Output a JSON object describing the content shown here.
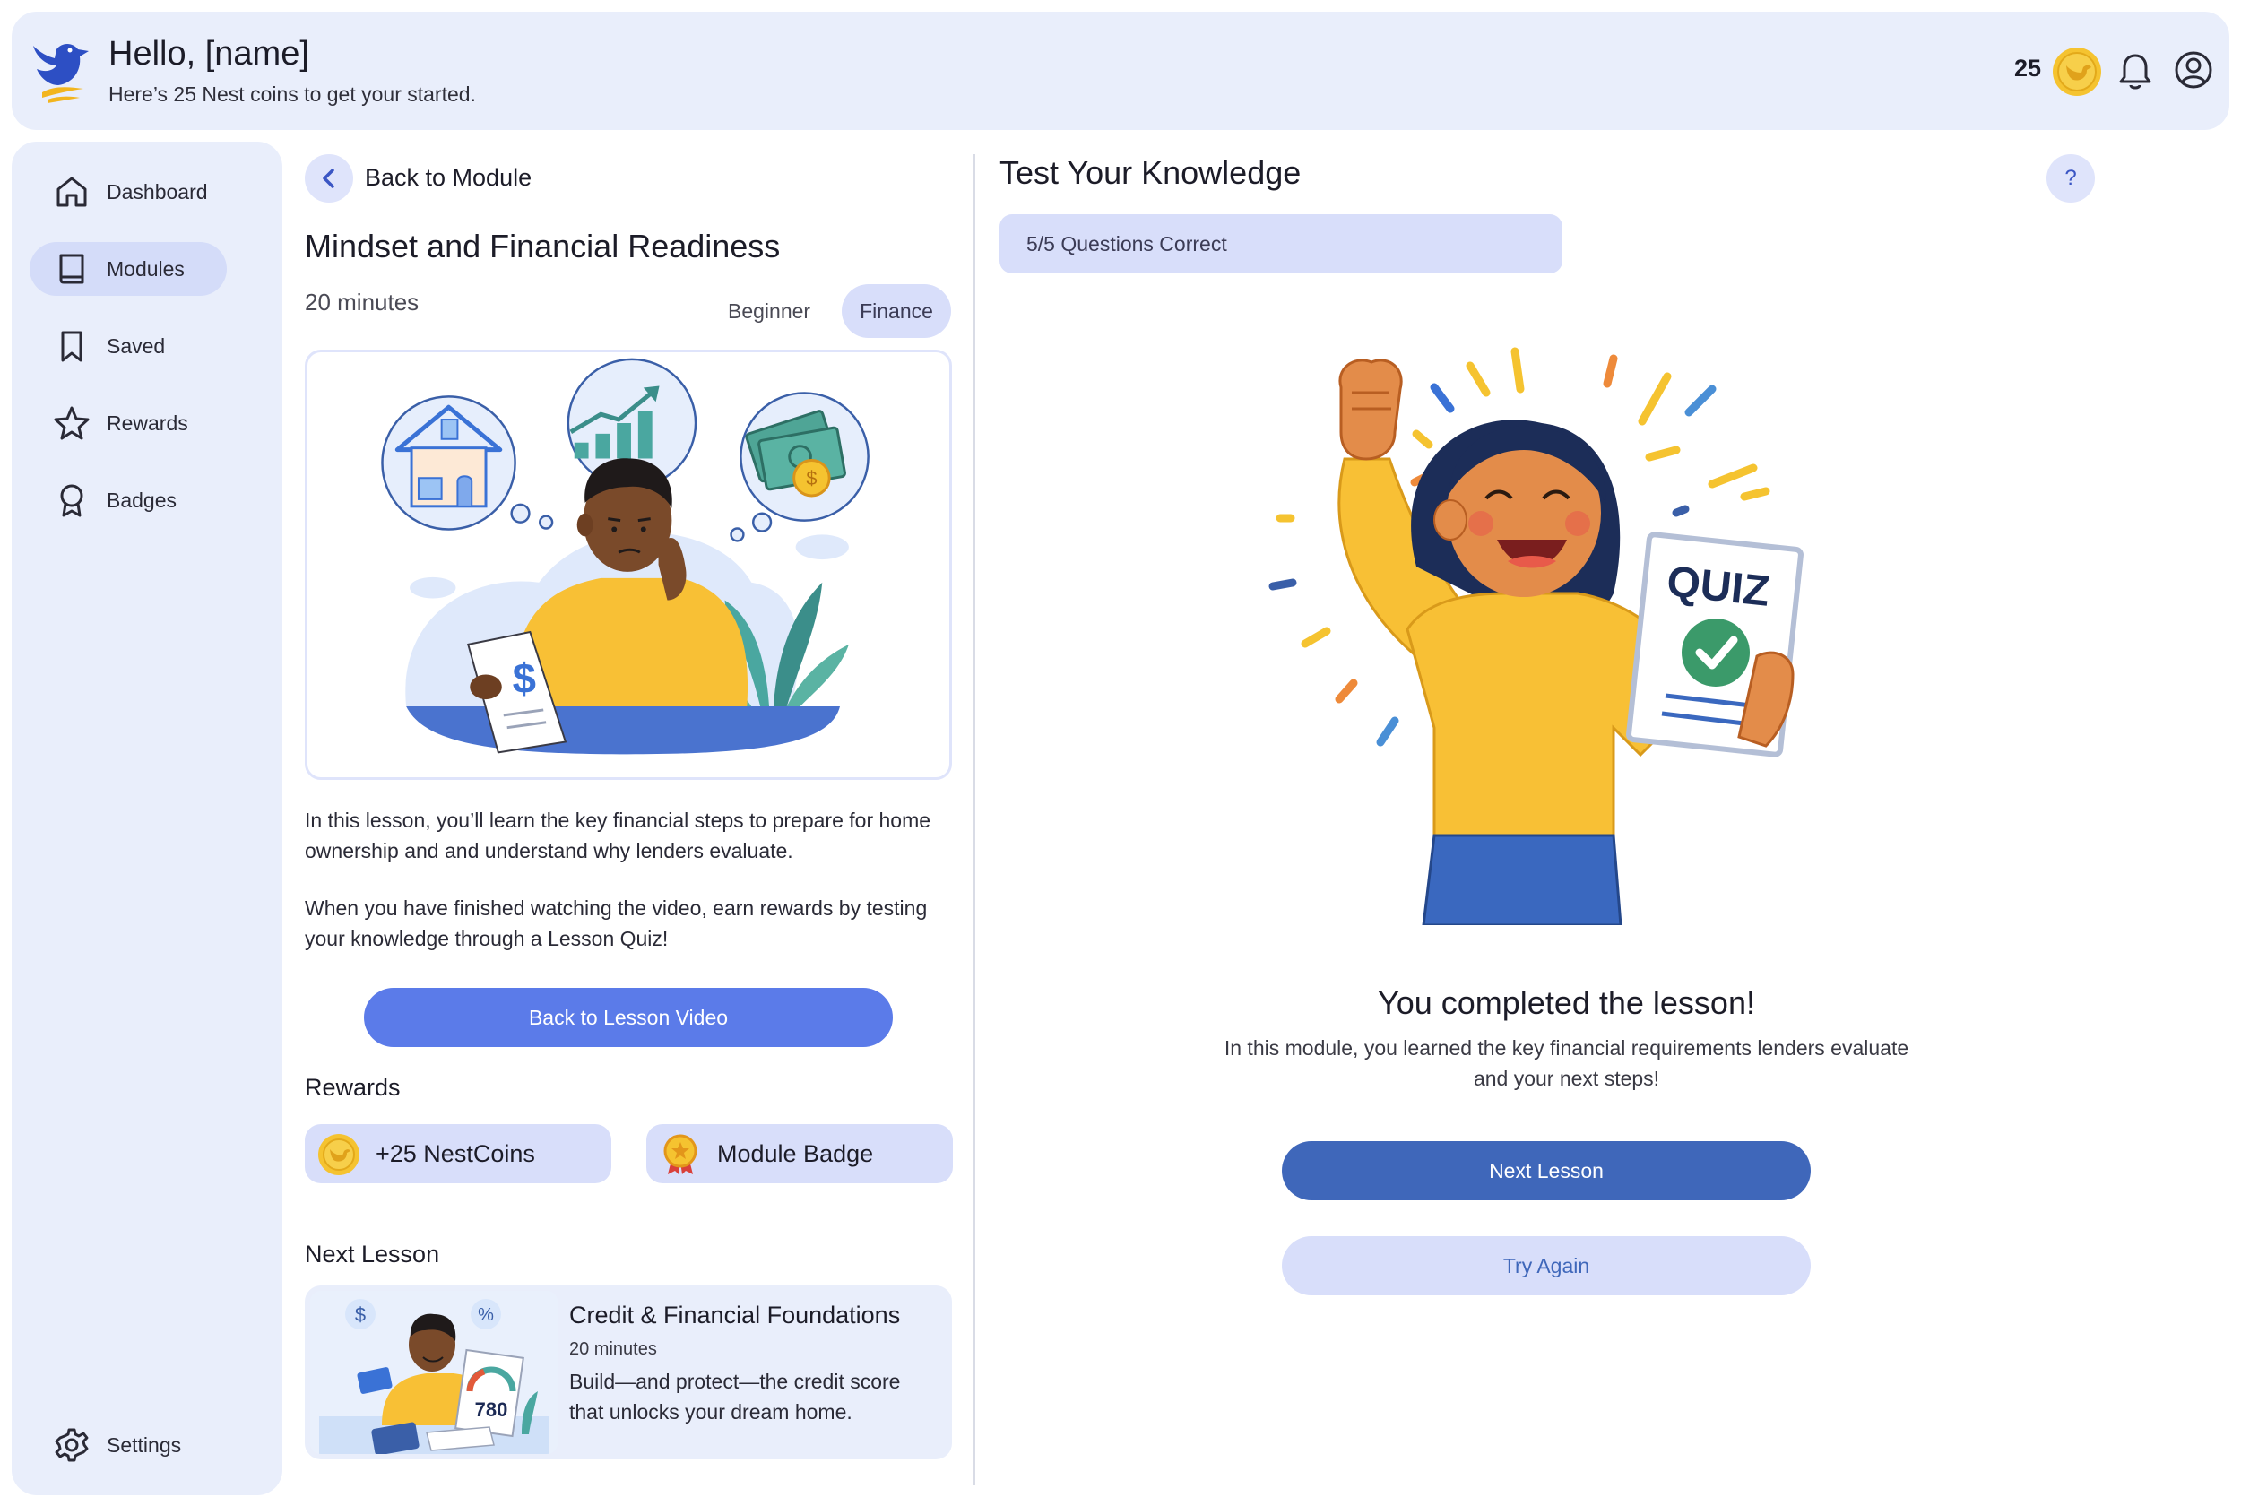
{
  "header": {
    "greeting": "Hello, [name]",
    "subtitle": "Here’s 25 Nest coins to get your started.",
    "coin_count": "25"
  },
  "sidebar": {
    "items": [
      {
        "label": "Dashboard",
        "icon": "home-icon"
      },
      {
        "label": "Modules",
        "icon": "book-icon",
        "active": true
      },
      {
        "label": "Saved",
        "icon": "bookmark-icon"
      },
      {
        "label": "Rewards",
        "icon": "star-icon"
      },
      {
        "label": "Badges",
        "icon": "badge-icon"
      }
    ],
    "settings_label": "Settings"
  },
  "lesson": {
    "back_label": "Back to Module",
    "title": "Mindset and Financial Readiness",
    "duration": "20 minutes",
    "tags": [
      "Beginner",
      "Finance"
    ],
    "description": "In this lesson, you’ll learn the key financial steps to prepare for home ownership and and understand why lenders evaluate.",
    "finish_text": "When you have finished watching the video, earn rewards by testing your knowledge through a Lesson Quiz!",
    "video_button": "Back to Lesson Video"
  },
  "rewards": {
    "heading": "Rewards",
    "items": [
      {
        "label": "+25 NestCoins",
        "icon": "coin-icon"
      },
      {
        "label": "Module Badge",
        "icon": "medal-icon"
      }
    ]
  },
  "next_lesson": {
    "heading": "Next Lesson",
    "title": "Credit & Financial Foundations",
    "duration": "20 minutes",
    "description": "Build—and protect—the credit score that unlocks your dream home.",
    "thumb_score": "780"
  },
  "quiz": {
    "title": "Test Your Knowledge",
    "help": "?",
    "score": "5/5 Questions Correct",
    "illustration_label": "QUIZ",
    "completed_title": "You completed the lesson!",
    "completed_text": "In this module, you learned the key financial requirements lenders evaluate and your next steps!",
    "next_button": "Next Lesson",
    "retry_button": "Try Again"
  },
  "colors": {
    "accent": "#5b7be9",
    "accent_dark": "#3f67ba",
    "panel": "#e9eefb",
    "pill": "#d8defa",
    "coin": "#f5c330"
  }
}
